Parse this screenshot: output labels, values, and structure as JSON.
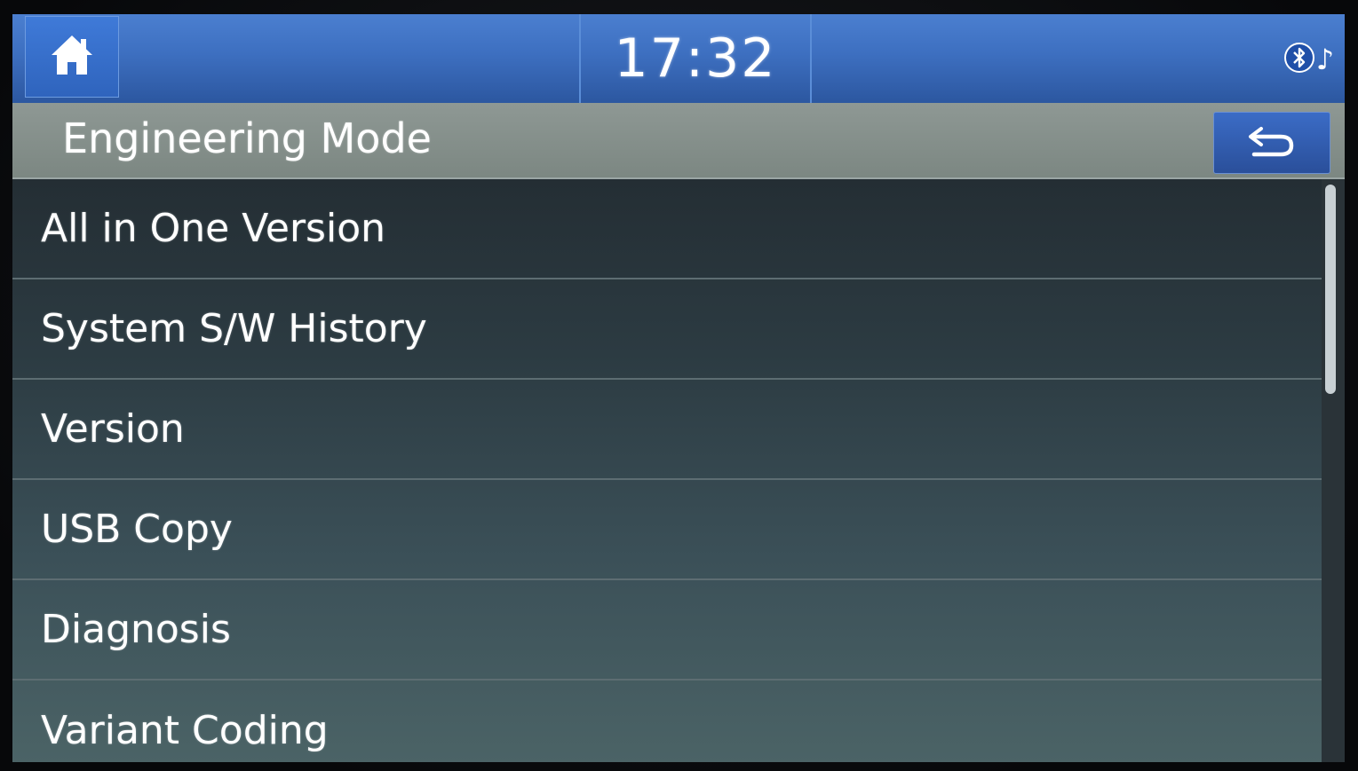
{
  "status_bar": {
    "home_icon": "home-icon",
    "time": "17:32",
    "bluetooth_icon": "bluetooth-icon",
    "music_icon": "music-note-icon",
    "accent_color": "#3d6fc0"
  },
  "header": {
    "title": "Engineering Mode",
    "back_icon": "back-arrow-icon"
  },
  "menu": {
    "items": [
      {
        "label": "All in One Version"
      },
      {
        "label": "System S/W History"
      },
      {
        "label": "Version"
      },
      {
        "label": "USB Copy"
      },
      {
        "label": "Diagnosis"
      },
      {
        "label": "Variant Coding"
      }
    ]
  }
}
